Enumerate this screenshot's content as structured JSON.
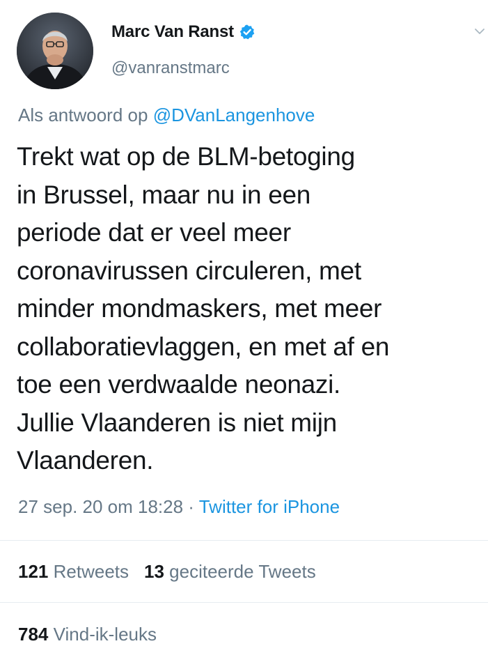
{
  "author": {
    "display_name": "Marc Van Ranst",
    "handle": "@vanranstmarc",
    "verified": true
  },
  "reply": {
    "prefix": "Als antwoord op",
    "mention": "@DVanLangenhove"
  },
  "tweet": {
    "text": "Trekt wat op de BLM-betoging\nin Brussel, maar nu in een\nperiode dat er veel meer\ncoronavirussen  circuleren, met\nminder mondmaskers, met meer\ncollaboratievlaggen, en met af en\ntoe een verdwaalde neonazi.\nJullie Vlaanderen is niet mijn\nVlaanderen."
  },
  "meta": {
    "timestamp": "27 sep. 20 om 18:28",
    "separator": "·",
    "source": "Twitter for iPhone"
  },
  "stats": {
    "retweets_count": "121",
    "retweets_label": "Retweets",
    "quotes_count": "13",
    "quotes_label": "geciteerde Tweets",
    "likes_count": "784",
    "likes_label": "Vind-ik-leuks"
  },
  "icons": {
    "verified": "verified-badge-icon",
    "menu": "chevron-down-icon"
  },
  "colors": {
    "link": "#1b95e0",
    "secondary_text": "#657786",
    "primary_text": "#14171a",
    "divider": "#e6ecf0"
  }
}
